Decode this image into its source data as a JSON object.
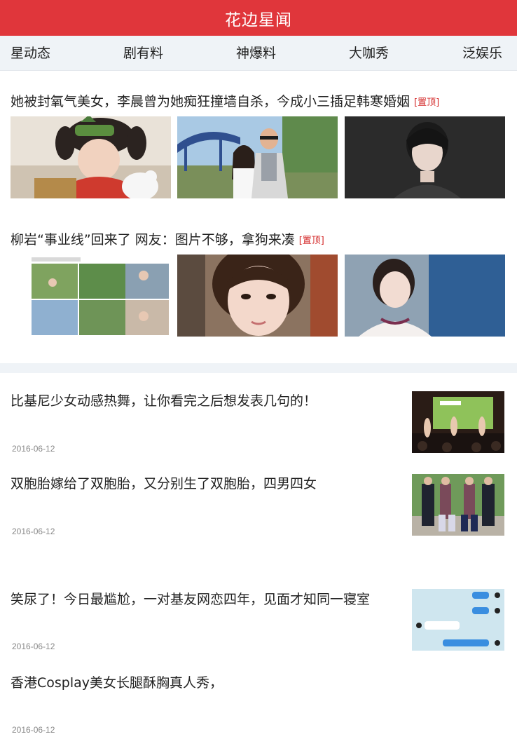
{
  "header": {
    "title": "花边星闻"
  },
  "nav": {
    "tabs": [
      {
        "label": "星动态"
      },
      {
        "label": "剧有料"
      },
      {
        "label": "神爆料"
      },
      {
        "label": "大咖秀"
      },
      {
        "label": "泛娱乐"
      }
    ]
  },
  "featured": [
    {
      "title": "她被封氧气美女，李晨曾为她痴狂撞墙自杀，今成小三插足韩寒婚姻",
      "badge": "[置顶]",
      "images": [
        "girl-in-fur-hat-photo",
        "couple-at-amusement-park-photo",
        "woman-portrait-dark-background-photo"
      ]
    },
    {
      "title": "柳岩“事业线”回来了 网友：图片不够，拿狗来凑",
      "badge": "[置顶]",
      "images": [
        "photo-collage-screenshot",
        "selfie-girl-photo",
        "woman-outdoor-photo"
      ]
    }
  ],
  "news": [
    {
      "title": "比基尼少女动感热舞，让你看完之后想发表几句的！",
      "date": "2016-06-12",
      "thumb": "stage-dance-photo"
    },
    {
      "title": "双胞胎嫁给了双胞胎，又分别生了双胞胎，四男四女",
      "date": "2016-06-12",
      "thumb": "twin-family-photo"
    },
    {
      "title": "笑尿了！今日最尴尬，一对基友网恋四年，见面才知同一寝室",
      "date": "2016-06-12",
      "thumb": "chat-screenshot"
    },
    {
      "title": "香港Cosplay美女长腿酥胸真人秀，",
      "date": "2016-06-12",
      "thumb": ""
    }
  ],
  "colors": {
    "header": "#e0363b",
    "nav_bg": "#eff3f7",
    "badge": "#d42b2b",
    "date": "#888888"
  }
}
